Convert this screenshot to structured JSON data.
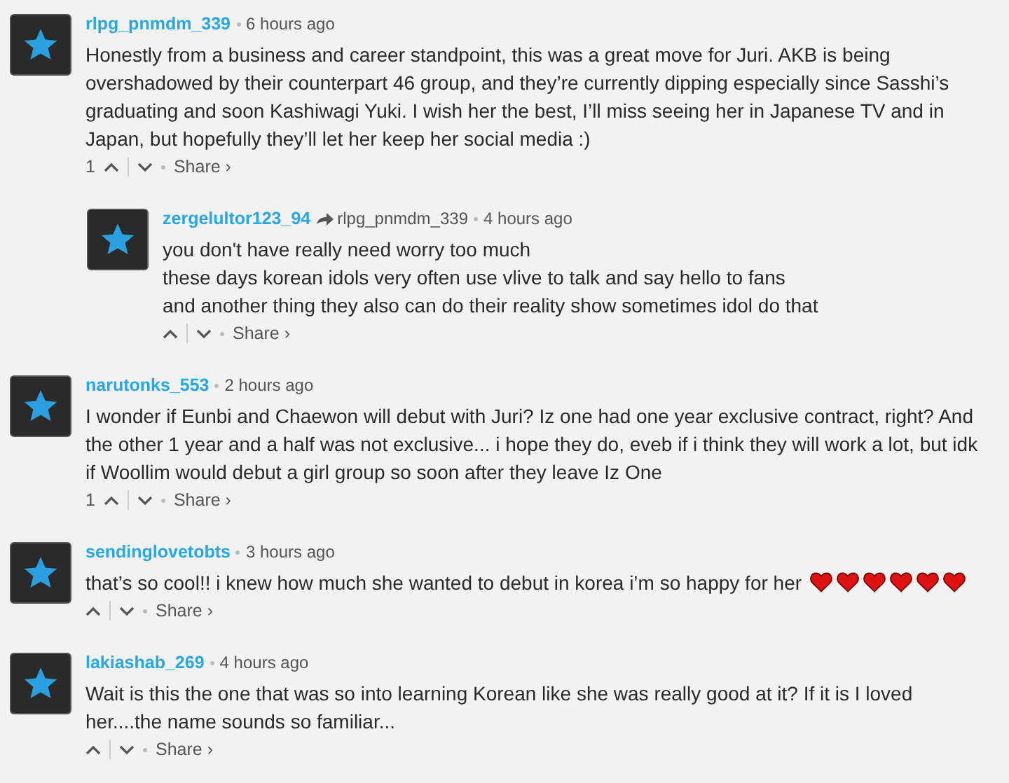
{
  "comments": [
    {
      "username": "rlpg_pnmdm_339",
      "time": "6 hours ago",
      "body": [
        "Honestly from a business and career standpoint, this was a great move for Juri. AKB is being",
        "overshadowed by their counterpart 46 group, and they’re currently dipping especially since Sasshi’s",
        "graduating and soon Kashiwagi Yuki. I wish her the best, I’ll miss seeing her in Japanese TV and in",
        "Japan, but hopefully they’ll let her keep her social media :)"
      ],
      "votes": "1",
      "share": "Share ›",
      "children": [
        {
          "username": "zergelultor123_94",
          "reply_to": "rlpg_pnmdm_339",
          "time": "4 hours ago",
          "body": [
            "you don't have really need worry too much",
            "these days korean idols very often use vlive to talk and say hello to fans",
            "and another thing they also can do their reality show sometimes idol do that"
          ],
          "share": "Share ›"
        }
      ]
    },
    {
      "username": "narutonks_553",
      "time": "2 hours ago",
      "body": [
        "I wonder if Eunbi and Chaewon will debut with Juri? Iz one had one year exclusive contract, right? And",
        "the other 1 year and a half was not exclusive... i hope they do, eveb if i think they will work a lot, but idk",
        "if Woollim would debut a girl group so soon after they leave Iz One"
      ],
      "votes": "1",
      "share": "Share ›"
    },
    {
      "username": "sendinglovetobts",
      "time": "3 hours ago",
      "body": [
        "that’s so cool!! i knew how much she wanted to debut in korea i’m so happy for her"
      ],
      "trailing_icons": [
        {
          "kind": "heart"
        },
        {
          "kind": "heart"
        },
        {
          "kind": "heart"
        },
        {
          "kind": "heart"
        },
        {
          "kind": "heart"
        },
        {
          "kind": "heart"
        }
      ],
      "share": "Share ›"
    },
    {
      "username": "lakiashab_269",
      "time": "4 hours ago",
      "body": [
        "Wait is this the one that was so into learning Korean like she was really good at it? If it is I loved",
        "her....the name sounds so familiar..."
      ],
      "share": "Share ›"
    }
  ]
}
